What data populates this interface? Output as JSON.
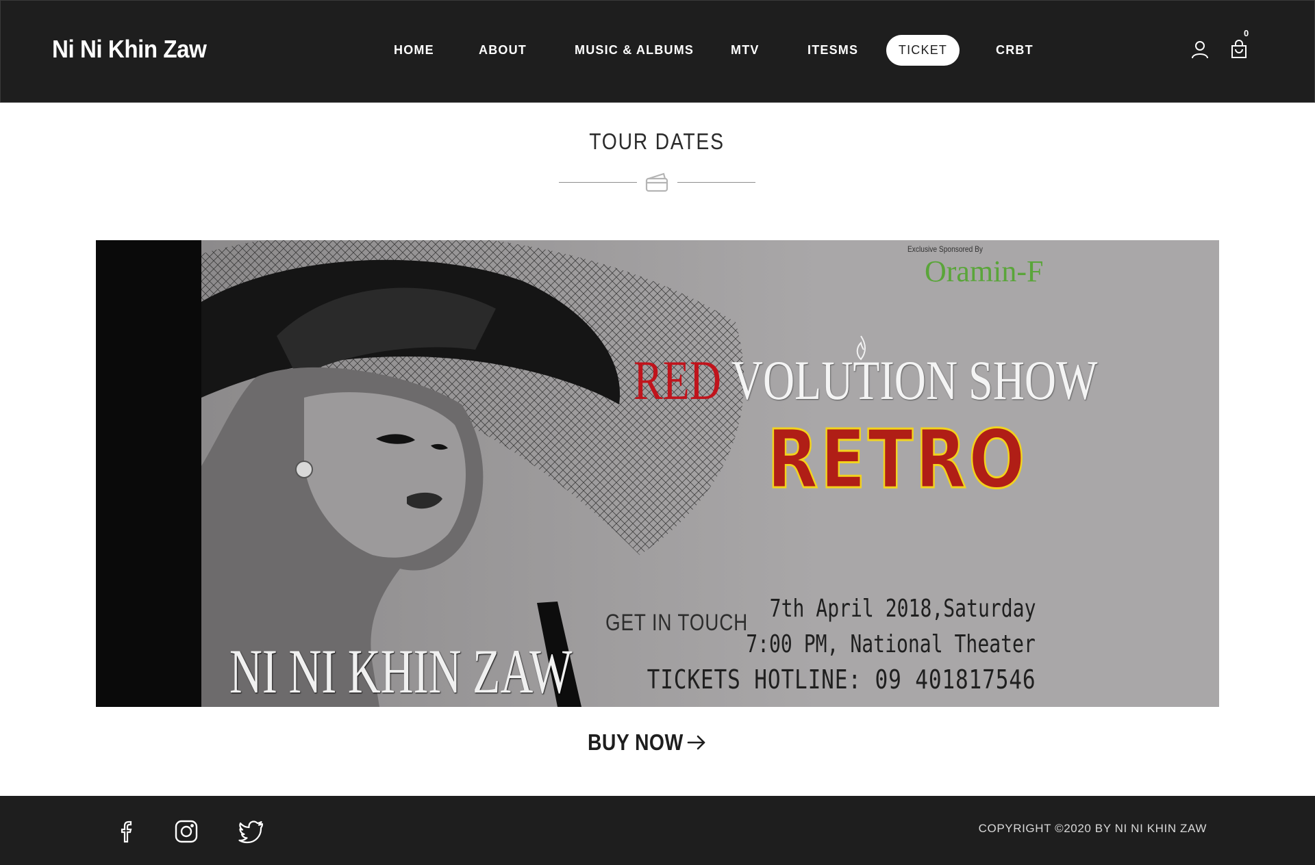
{
  "header": {
    "brand": "Ni Ni Khin Zaw",
    "nav": [
      {
        "label": "HOME"
      },
      {
        "label": "ABOUT"
      },
      {
        "label": "MUSIC & ALBUMS"
      },
      {
        "label": "MTV"
      },
      {
        "label": "ITESMS"
      },
      {
        "label": "TICKET",
        "active": true
      },
      {
        "label": "CRBT"
      }
    ],
    "icons": [
      "user-icon",
      "cart-icon"
    ],
    "cart_count": "0"
  },
  "main": {
    "section_title": "TOUR DATES",
    "divider_icon": "ticket-icon",
    "banner": {
      "sponsor_label": "Exclusive Sponsored By",
      "sponsor_name": "Oramin-F",
      "show_title_red": "RED",
      "show_title_rest": "VOLUTION SHOW",
      "subtitle": "RETRO",
      "get_in_touch": "GET IN TOUCH",
      "date": "7th April 2018,Saturday",
      "time_venue": "7:00 PM, National Theater",
      "hotline": "TICKETS HOTLINE: 09 401817546",
      "artist_name": "NI NI KHIN ZAW"
    },
    "buy_now": {
      "label": "BUY NOW",
      "icon": "arrow-right-icon"
    }
  },
  "footer": {
    "social_icons": [
      "facebook-icon",
      "instagram-icon",
      "twitter-icon"
    ],
    "copyright": "COPYRIGHT ©2020 BY NI NI KHIN ZAW"
  },
  "colors": {
    "header_bg": "#1e1e1e",
    "footer_bg": "#1e1e1e",
    "banner_bg": "#a9a7a8",
    "accent_red": "#c0141c",
    "retro_yellow": "#f2d31e",
    "sponsor_green": "#5aa53a"
  }
}
